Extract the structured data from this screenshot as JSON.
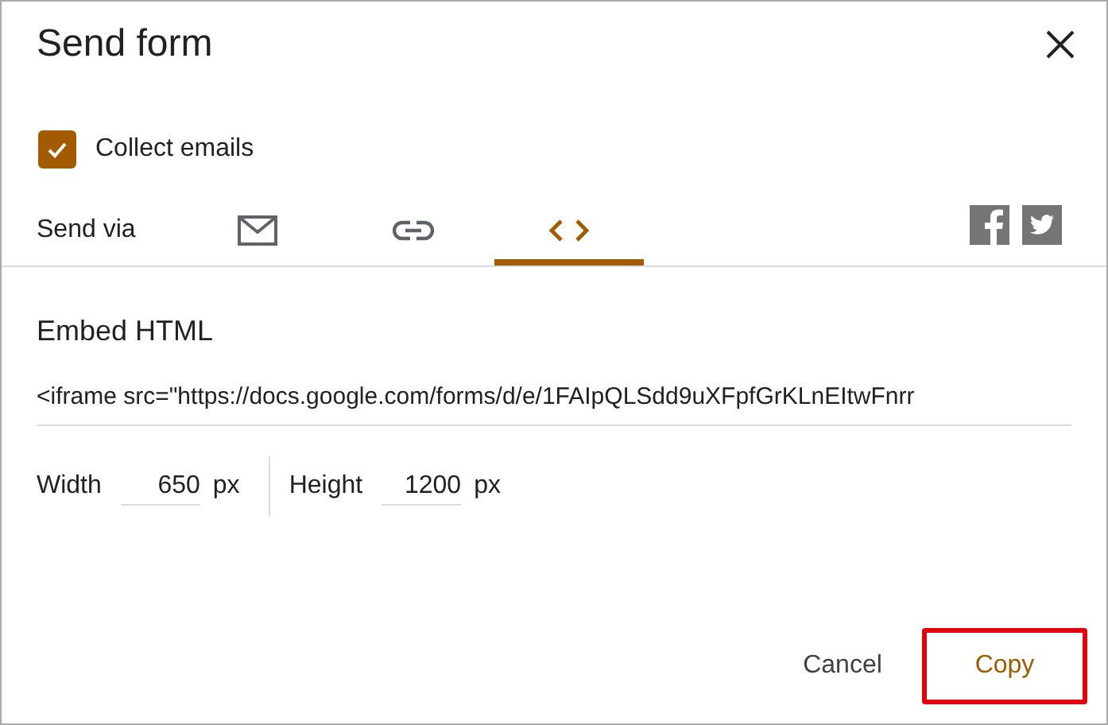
{
  "dialog": {
    "title": "Send form"
  },
  "collect_emails": {
    "label": "Collect emails",
    "checked": true
  },
  "send_via": {
    "label": "Send via",
    "tabs": [
      {
        "kind": "email",
        "selected": false
      },
      {
        "kind": "link",
        "selected": false
      },
      {
        "kind": "embed",
        "selected": true
      }
    ]
  },
  "embed": {
    "heading": "Embed HTML",
    "value": "<iframe src=\"https://docs.google.com/forms/d/e/1FAIpQLSdd9uXFpfGrKLnEItwFnrr",
    "width": {
      "label": "Width",
      "value": "650",
      "unit": "px"
    },
    "height": {
      "label": "Height",
      "value": "1200",
      "unit": "px"
    }
  },
  "buttons": [
    {
      "label": "Cancel",
      "highlighted": false
    },
    {
      "label": "Copy",
      "highlighted": true
    }
  ]
}
